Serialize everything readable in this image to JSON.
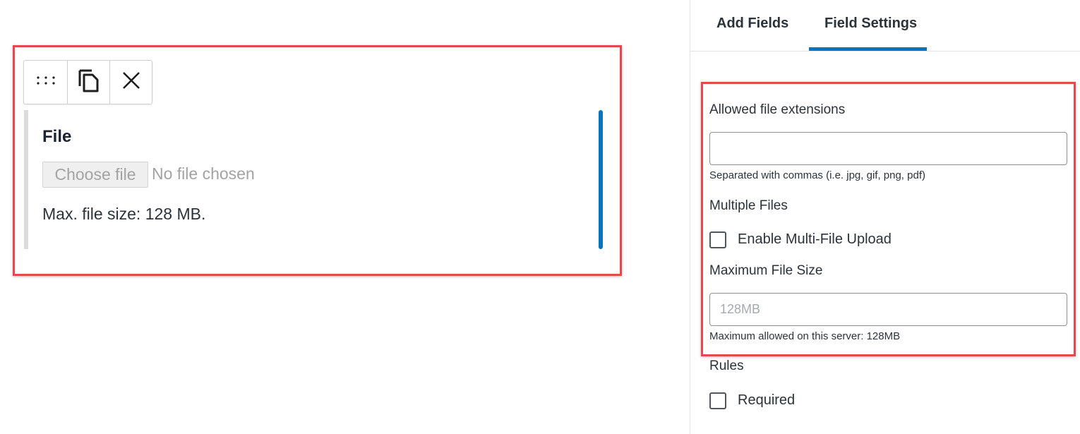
{
  "canvas": {
    "toolbar": {
      "drag_icon": "drag-handle-icon",
      "duplicate_icon": "duplicate-icon",
      "remove_icon": "close-icon"
    },
    "field": {
      "label": "File",
      "choose_button": "Choose file",
      "no_file_text": "No file chosen",
      "max_size_text": "Max. file size: 128 MB."
    }
  },
  "sidebar": {
    "tabs": [
      {
        "label": "Add Fields",
        "active": false
      },
      {
        "label": "Field Settings",
        "active": true
      }
    ],
    "allowed_extensions": {
      "label": "Allowed file extensions",
      "value": "",
      "help": "Separated with commas (i.e. jpg, gif, png, pdf)"
    },
    "multiple_files": {
      "label": "Multiple Files",
      "checkbox_label": "Enable Multi-File Upload",
      "checked": false
    },
    "max_file_size": {
      "label": "Maximum File Size",
      "placeholder": "128MB",
      "help": "Maximum allowed on this server: 128MB"
    },
    "rules": {
      "label": "Rules",
      "checkbox_label": "Required",
      "checked": false
    }
  },
  "colors": {
    "accent": "#0a73be",
    "highlight": "#e5484d"
  }
}
